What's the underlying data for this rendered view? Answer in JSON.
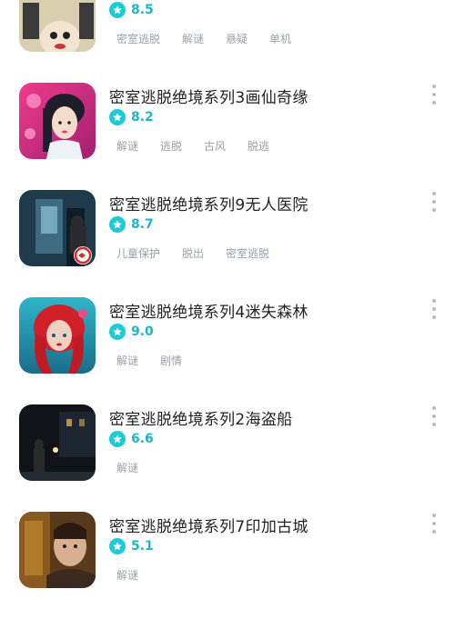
{
  "rows": [
    {
      "title": "",
      "rating": "8.5",
      "tags": [
        "密室逃脱",
        "解谜",
        "悬疑",
        "单机"
      ],
      "thumb": "card-with-chinese-text",
      "show_menu": false
    },
    {
      "title": "密室逃脱绝境系列3画仙奇缘",
      "rating": "8.2",
      "tags": [
        "解谜",
        "逃脱",
        "古风",
        "脱逃"
      ],
      "thumb": "ancient-lady-portrait"
    },
    {
      "title": "密室逃脱绝境系列9无人医院",
      "rating": "8.7",
      "tags": [
        "儿童保护",
        "脱出",
        "密室逃脱"
      ],
      "thumb": "dark-hospital-corridor"
    },
    {
      "title": "密室逃脱绝境系列4迷失森林",
      "rating": "9.0",
      "tags": [
        "解谜",
        "剧情"
      ],
      "thumb": "red-haired-girl"
    },
    {
      "title": "密室逃脱绝境系列2海盗船",
      "rating": "6.6",
      "tags": [
        "解谜"
      ],
      "thumb": "night-street-figure"
    },
    {
      "title": "密室逃脱绝境系列7印加古城",
      "rating": "5.1",
      "tags": [
        "解谜"
      ],
      "thumb": "man-in-ancient-ruins"
    }
  ],
  "colors": {
    "accent": "#1ccbd8",
    "score": "#1bb7c6",
    "title": "#222222",
    "tag": "#9aa0a6"
  },
  "icons": {
    "rating": "star-icon",
    "menu": "more-vertical-icon"
  }
}
